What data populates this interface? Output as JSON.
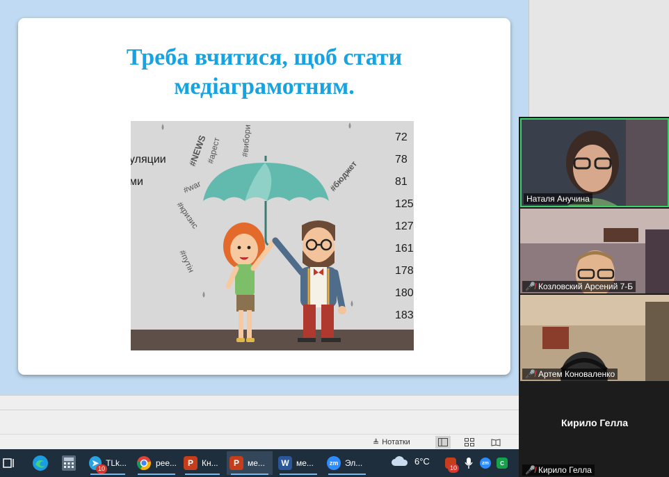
{
  "slide": {
    "title_line1": "Треба вчитися, щоб стати",
    "title_line2": "медіаграмотним.",
    "image": {
      "left_fragments": [
        "уляции",
        "ми"
      ],
      "numbers": [
        "72",
        "78",
        "81",
        "125",
        "127",
        "161",
        "178",
        "180",
        "183"
      ],
      "hashtags": [
        "#NEWS",
        "#арест",
        "#вибори",
        "#кризис",
        "#war",
        "#путін",
        "#бюджет"
      ]
    }
  },
  "statusbar": {
    "notes_label": "Нотатки"
  },
  "taskbar": {
    "apps": [
      {
        "label": "TLk...",
        "badge": "10"
      },
      {
        "label": "рее..."
      },
      {
        "label": "Кн..."
      },
      {
        "label": "ме..."
      },
      {
        "label": "ме..."
      },
      {
        "label": "Эл..."
      }
    ],
    "temperature": "6°C",
    "tray_badge": "10"
  },
  "zoom": {
    "participants": [
      {
        "name": "Наталя Анучина",
        "muted": false
      },
      {
        "name": "Козловский Арсений 7-Б",
        "muted": true
      },
      {
        "name": "Артем Коноваленко",
        "muted": true
      },
      {
        "name": "Кирило Гелла",
        "muted": true,
        "display_name": "Кирило Гелла"
      }
    ]
  },
  "colors": {
    "title": "#17a3e1",
    "speaking_border": "#3ad06a",
    "taskbar": "#1f2e3d",
    "umbrella": "#62b9ae"
  }
}
